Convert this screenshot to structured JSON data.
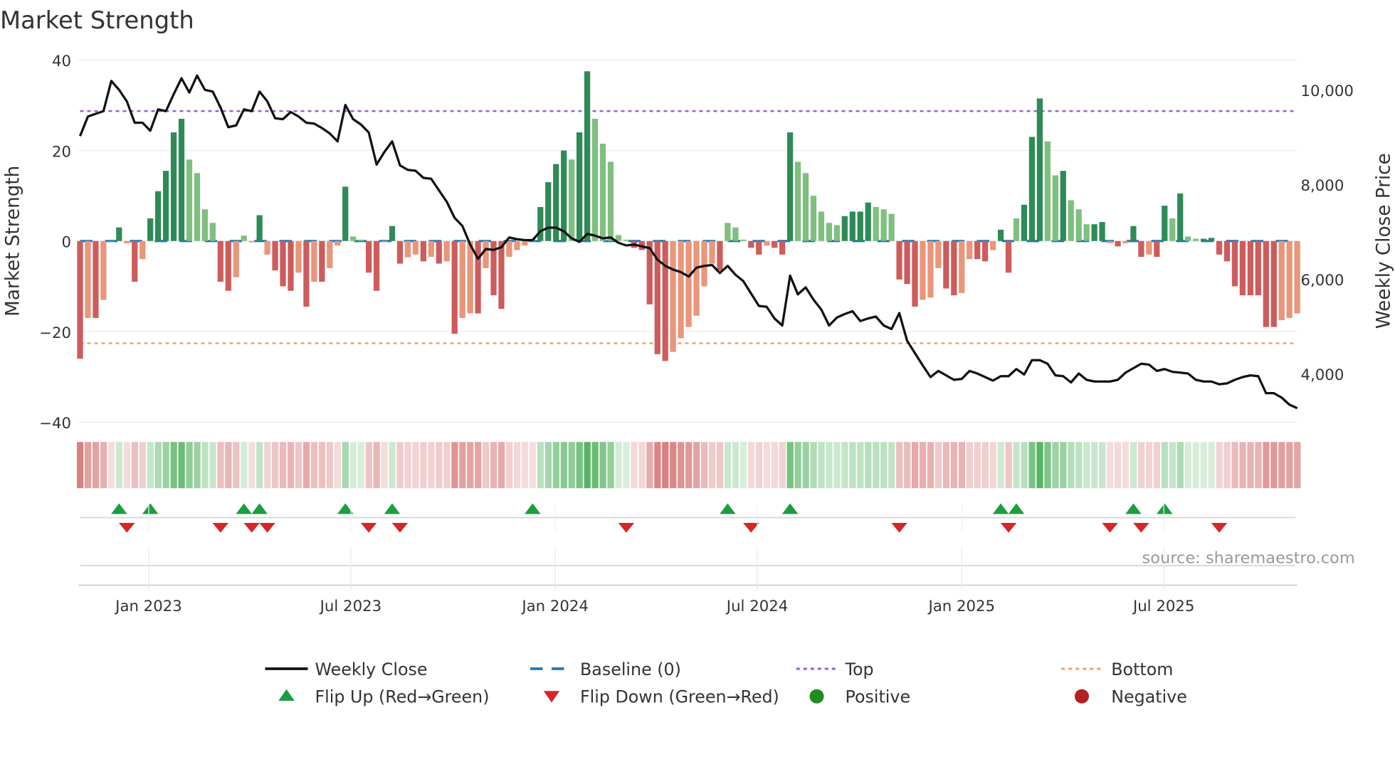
{
  "chart_data": {
    "type": "bar",
    "title": "Market Strength",
    "ylabel": "Market Strength",
    "y2label": "Weekly Close Price",
    "ylim": [
      -40,
      40
    ],
    "y2lim": [
      3000,
      10000
    ],
    "yticks": [
      40,
      20,
      0,
      -20,
      -40
    ],
    "ytick_labels": [
      "40",
      "20",
      "0",
      "−20",
      "−40"
    ],
    "y2ticks": [
      10000,
      8000,
      6000,
      4000
    ],
    "y2tick_labels": [
      "10,000",
      "8,000",
      "6,000",
      "4,000"
    ],
    "x_unit": "week index",
    "xticks": [
      {
        "x": 8.8,
        "label": "Jan 2023"
      },
      {
        "x": 34.7,
        "label": "Jul 2023"
      },
      {
        "x": 60.9,
        "label": "Jan 2024"
      },
      {
        "x": 86.8,
        "label": "Jul 2024"
      },
      {
        "x": 113,
        "label": "Jan 2025"
      },
      {
        "x": 138.9,
        "label": "Jul 2025"
      }
    ],
    "top_level": 28.7,
    "bottom_level": -22.6,
    "baseline": 0,
    "strength": [
      -26,
      -17,
      -17,
      -13,
      0,
      3,
      -0.5,
      -9,
      -4,
      5,
      11,
      15.5,
      24,
      27,
      18,
      15,
      7,
      4,
      -9,
      -11,
      -8,
      1.2,
      -0.3,
      5.7,
      -3,
      -6.5,
      -10,
      -11,
      -7,
      -14.5,
      -9,
      -9,
      -6,
      -1,
      12,
      1,
      0.3,
      -7,
      -11,
      -0.3,
      3.3,
      -5,
      -3.6,
      -3,
      -4.5,
      -3.5,
      -5,
      -4.5,
      -20.5,
      -17,
      -16,
      -16,
      -6,
      -12,
      -15,
      -3.5,
      -2,
      -1,
      0,
      7.5,
      13,
      17,
      20,
      18,
      24,
      37.5,
      27,
      21.5,
      17.5,
      1.3,
      0.3,
      -1.5,
      -2,
      -14,
      -25,
      -26.5,
      -24.5,
      -21.5,
      -19,
      -16.5,
      -10,
      -5,
      -6.5,
      4,
      3,
      0.3,
      -1.5,
      -3,
      -1,
      -1.5,
      -3,
      24,
      17.5,
      15,
      10,
      6.5,
      4,
      3.5,
      5.5,
      6.5,
      6.5,
      8.5,
      7.5,
      7,
      6,
      -8.5,
      -9.5,
      -14.5,
      -13,
      -12.5,
      -6,
      -10.5,
      -12,
      -11.5,
      -4,
      -4,
      -4.5,
      -2,
      2.5,
      -7,
      5,
      8,
      23,
      31.5,
      22,
      14.5,
      15.5,
      9,
      7,
      3.7,
      3.7,
      4.2,
      -0.5,
      -1.2,
      -0.5,
      3.3,
      -3.5,
      -3,
      -3.5,
      7.8,
      5,
      10.5,
      1,
      0.5,
      0.5,
      0.7,
      -3,
      -4.5,
      -10,
      -12,
      -12,
      -12,
      -19,
      -19,
      -17.5,
      -17,
      -16
    ],
    "weekly_close": [
      9022,
      9436,
      9492,
      9549,
      10188,
      10000,
      9756,
      9304,
      9304,
      9135,
      9586,
      9549,
      9906,
      10244,
      9944,
      10300,
      10000,
      9962,
      9624,
      9210,
      9248,
      9586,
      9549,
      9962,
      9756,
      9398,
      9380,
      9530,
      9436,
      9304,
      9285,
      9192,
      9079,
      8910,
      9680,
      9380,
      9267,
      9098,
      8421,
      8684,
      8910,
      8402,
      8308,
      8289,
      8139,
      8120,
      7876,
      7631,
      7293,
      7124,
      6729,
      6428,
      6635,
      6616,
      6672,
      6879,
      6842,
      6823,
      6823,
      7011,
      7086,
      7086,
      7011,
      6861,
      6785,
      6955,
      6917,
      6861,
      6879,
      6766,
      6710,
      6729,
      6691,
      6654,
      6409,
      6278,
      6202,
      6146,
      6052,
      6240,
      6278,
      6297,
      6127,
      6278,
      6090,
      5958,
      5695,
      5432,
      5413,
      5168,
      5018,
      6071,
      5676,
      5826,
      5563,
      5357,
      5018,
      5187,
      5262,
      5319,
      5112,
      5168,
      5206,
      5018,
      4943,
      5281,
      4698,
      4435,
      4172,
      3928,
      4059,
      3965,
      3871,
      3890,
      4059,
      4003,
      3928,
      3853,
      3947,
      3947,
      4097,
      3984,
      4285,
      4285,
      4210,
      3965,
      3947,
      3815,
      4003,
      3871,
      3834,
      3834,
      3834,
      3871,
      4022,
      4116,
      4210,
      4191,
      4059,
      4097,
      4040,
      4022,
      4003,
      3871,
      3834,
      3834,
      3777,
      3796,
      3871,
      3928,
      3965,
      3947,
      3589,
      3589,
      3495,
      3345,
      3270
    ],
    "flip_up": [
      5,
      9,
      21,
      23,
      34,
      40,
      58,
      83,
      91,
      118,
      120,
      135,
      139
    ],
    "flip_down": [
      6,
      18,
      22,
      24,
      37,
      41,
      70,
      86,
      105,
      119,
      132,
      136,
      146
    ],
    "legend": {
      "placement": "bottom",
      "items": [
        "Weekly Close",
        "Baseline (0)",
        "Top",
        "Bottom",
        "Flip Up (Red→Green)",
        "Flip Down (Green→Red)",
        "Positive",
        "Negative"
      ]
    },
    "source": "source: sharemaestro.com"
  },
  "colors": {
    "pos_strong": "#2e8b57",
    "pos_weak": "#7fbf7f",
    "neg_strong": "#cd5c5c",
    "neg_weak": "#e9967a",
    "baseline": "#1f77b4",
    "top": "#9a5fd6",
    "bottom": "#f4a460",
    "line": "#111111",
    "flip_up": "#1a9e3f",
    "flip_down": "#d62728",
    "positive": "#228b22",
    "negative": "#b22222"
  }
}
